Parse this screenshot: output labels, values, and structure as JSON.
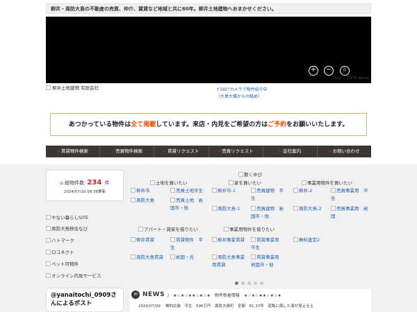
{
  "header": {
    "tagline": "柳井・周防大島の不動産の売買、仲介、賃貸など地域と共に60年。柳井土地建物へおまかせください。"
  },
  "video": {
    "controls": [
      "zoom-in",
      "zoom-out",
      "vr-view"
    ],
    "help_label": "Help",
    "viewer_label": "THETA 360.biz"
  },
  "logo": {
    "alt": "柳井土地建物 有限会社"
  },
  "camera_caption": {
    "line1": "↑360°カメラで物件紹介中",
    "line2": "（大島大橋からの眺め）"
  },
  "banner": {
    "part1": "あつかっている物件は",
    "hl1": "全て掲載",
    "part2": "しています。来店・内見をご希望の方は",
    "hl2": "ご予約",
    "part3": "をお願いいたします。"
  },
  "nav": [
    "賃貸物件検索",
    "売買物件検索",
    "賃貸リクエスト",
    "売買リクエスト",
    "会社案内",
    "お問い合わせ"
  ],
  "count": {
    "label": "総物件数",
    "number": "234",
    "unit": "件",
    "updated": "2024/07/10 08:38更新"
  },
  "side_links": [
    "やない暮らしSITE",
    "周防大島移住なび",
    "ハトマーク",
    "ロコネクト",
    "ペット可物件",
    "オンライン内見サービス"
  ],
  "twitter": {
    "title": "@yanaitochi_0909さんによるポスト"
  },
  "categories": {
    "home_sm": "散くゆび",
    "land_buy": "土地を買いたい",
    "house_buy": "家を買いたい",
    "biz_buy": "事業用物件を買いたい",
    "apt_rent": "アパート・貸家を借りたい",
    "biz_rent": "事業用物件を借りたい"
  },
  "links": {
    "land": [
      "柳井市",
      "売買土地平生",
      "周防大島",
      "売買土地　岩国市・他"
    ],
    "house": [
      "柳井市-1",
      "売買建物　平生",
      "周防大島-1",
      "売買建物　岩国市・他"
    ],
    "biz": [
      "柳井-2",
      "売買事業用　平生",
      "周防大島-2",
      "売買事業用　岩国"
    ],
    "apt": [
      "柳井賃貸",
      "賃貸物件　平生",
      "周防大島賃貸",
      "岩国・光"
    ],
    "bizrent": [
      "柳井事業賃貸",
      "賃貸事業用　平生",
      "周防大島事業用賃貸",
      "賃貸事業用　岩国市・他"
    ],
    "extra": "無料査定2"
  },
  "news": {
    "title": "NEWS",
    "subtitle": "/　★☆★☆★★☆★☆★　物件新着情報　★☆★☆★★☆★☆★",
    "row_date": "2024/07/09",
    "row_text": "倹約広島　平生　590万円　周防大島町　全閉　81.37坪　道路に面した海が見える土"
  }
}
